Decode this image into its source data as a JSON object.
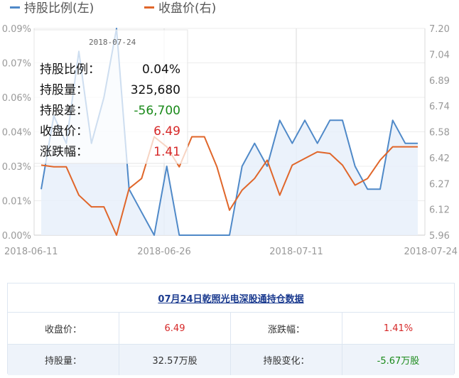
{
  "chart_data": {
    "type": "line",
    "legend": [
      {
        "name": "持股比例(左)",
        "color": "#4f89c8"
      },
      {
        "name": "收盘价(右)",
        "color": "#e0662a"
      }
    ],
    "x_ticks": [
      "2018-06-11",
      "2018-06-26",
      "2018-07-11",
      "2018-07-24"
    ],
    "y_left_ticks": [
      "0.09%",
      "0.07%",
      "0.06%",
      "0.04%",
      "0.03%",
      "0.01%",
      "0.00%"
    ],
    "y_left_range": [
      0,
      0.09
    ],
    "y_right_ticks": [
      "7.20",
      "7.04",
      "6.89",
      "6.74",
      "6.58",
      "6.42",
      "6.27",
      "6.12",
      "5.96"
    ],
    "y_right_range": [
      5.96,
      7.2
    ],
    "x": [
      "2018-06-11",
      "2018-06-12",
      "2018-06-13",
      "2018-06-14",
      "2018-06-15",
      "2018-06-19",
      "2018-06-20",
      "2018-06-21",
      "2018-06-22",
      "2018-06-25",
      "2018-06-26",
      "2018-06-27",
      "2018-06-28",
      "2018-06-29",
      "2018-07-02",
      "2018-07-03",
      "2018-07-04",
      "2018-07-05",
      "2018-07-06",
      "2018-07-09",
      "2018-07-10",
      "2018-07-11",
      "2018-07-12",
      "2018-07-13",
      "2018-07-16",
      "2018-07-17",
      "2018-07-18",
      "2018-07-19",
      "2018-07-20",
      "2018-07-23",
      "2018-07-24"
    ],
    "series": [
      {
        "name": "持股比例(左)",
        "axis": "left",
        "values": [
          0.02,
          0.052,
          0.04,
          0.08,
          0.04,
          0.06,
          0.09,
          0.02,
          0.01,
          0.0,
          0.03,
          0.0,
          0.0,
          0.0,
          0.0,
          0.0,
          0.03,
          0.04,
          0.03,
          0.05,
          0.04,
          0.05,
          0.04,
          0.05,
          0.05,
          0.03,
          0.02,
          0.02,
          0.05,
          0.04,
          0.04
        ]
      },
      {
        "name": "收盘价(右)",
        "axis": "right",
        "values": [
          6.38,
          6.37,
          6.37,
          6.2,
          6.13,
          6.13,
          5.96,
          6.24,
          6.3,
          6.55,
          6.49,
          6.37,
          6.55,
          6.55,
          6.37,
          6.11,
          6.23,
          6.3,
          6.41,
          6.2,
          6.38,
          6.42,
          6.46,
          6.45,
          6.38,
          6.26,
          6.3,
          6.41,
          6.49,
          6.49,
          6.49
        ]
      }
    ],
    "tooltip": {
      "date": "2018-07-24",
      "rows": [
        {
          "label": "持股比例：",
          "value": "0.04%",
          "color": "#111111"
        },
        {
          "label": "持股量：",
          "value": "325,680",
          "color": "#111111"
        },
        {
          "label": "持股差：",
          "value": "-56,700",
          "color": "#1a8a1a"
        },
        {
          "label": "收盘价：",
          "value": "6.49",
          "color": "#d62828"
        },
        {
          "label": "涨跌幅：",
          "value": "1.41",
          "color": "#d62828"
        }
      ]
    }
  },
  "table": {
    "title": "07月24日乾照光电深股通持仓数据",
    "rows": [
      [
        {
          "text": "收盘价：",
          "cls": ""
        },
        {
          "text": "6.49",
          "cls": "red"
        },
        {
          "text": "涨跌幅：",
          "cls": ""
        },
        {
          "text": "1.41%",
          "cls": "red"
        }
      ],
      [
        {
          "text": "持股量：",
          "cls": ""
        },
        {
          "text": "32.57万股",
          "cls": ""
        },
        {
          "text": "持股变化：",
          "cls": ""
        },
        {
          "text": "-5.67万股",
          "cls": "green"
        }
      ]
    ]
  }
}
